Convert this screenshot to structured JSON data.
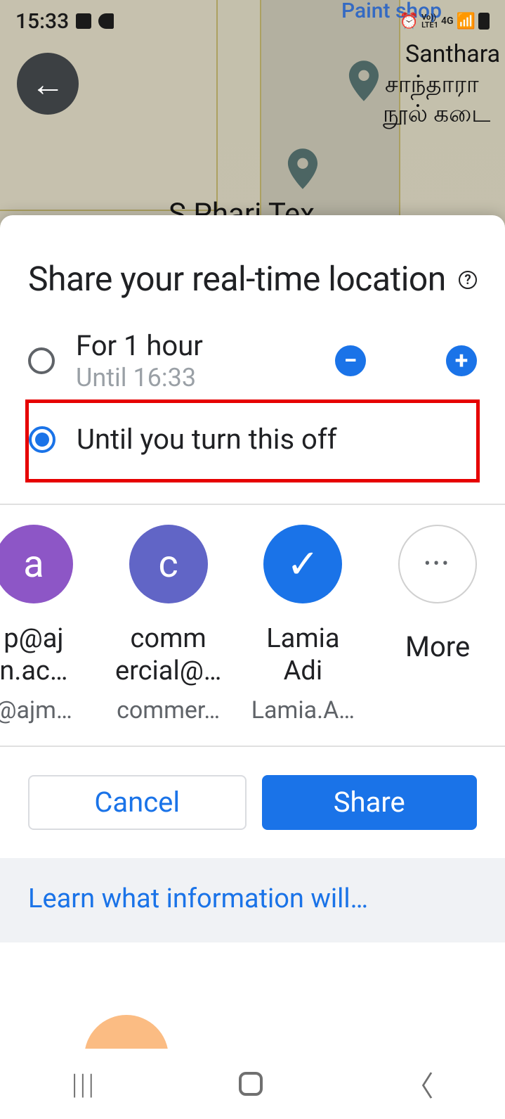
{
  "status": {
    "time": "15:33",
    "network": "4G",
    "carrier": "LTE1",
    "volte": "Vo))"
  },
  "map": {
    "poi_blue": "Paint shop",
    "poi_name1": "Santhara",
    "poi_name2": "சாந்தாரா",
    "poi_name3": "நூல் கடை",
    "poi_bottom": "S Phari Tex"
  },
  "sheet": {
    "title": "Share your real-time location",
    "option1": {
      "label": "For 1 hour",
      "sub": "Until 16:33"
    },
    "option2": {
      "label": "Until you turn this off"
    },
    "minus": "−",
    "plus": "+"
  },
  "contacts": [
    {
      "avatar": "a",
      "name1": "p@aj",
      "name2": "n.ac…",
      "email": "@ajm…"
    },
    {
      "avatar": "c",
      "name1": "comm",
      "name2": "ercial@…",
      "email": "commer…"
    },
    {
      "avatar": "check",
      "name1": "Lamia",
      "name2": "Adi",
      "email": "Lamia.A…"
    }
  ],
  "more_label": "More",
  "buttons": {
    "cancel": "Cancel",
    "share": "Share"
  },
  "learn": "Learn what information will…",
  "help_glyph": "?",
  "check_glyph": "✓",
  "dots_glyph": "•••",
  "nav_recent": "|||",
  "nav_back": "〈"
}
